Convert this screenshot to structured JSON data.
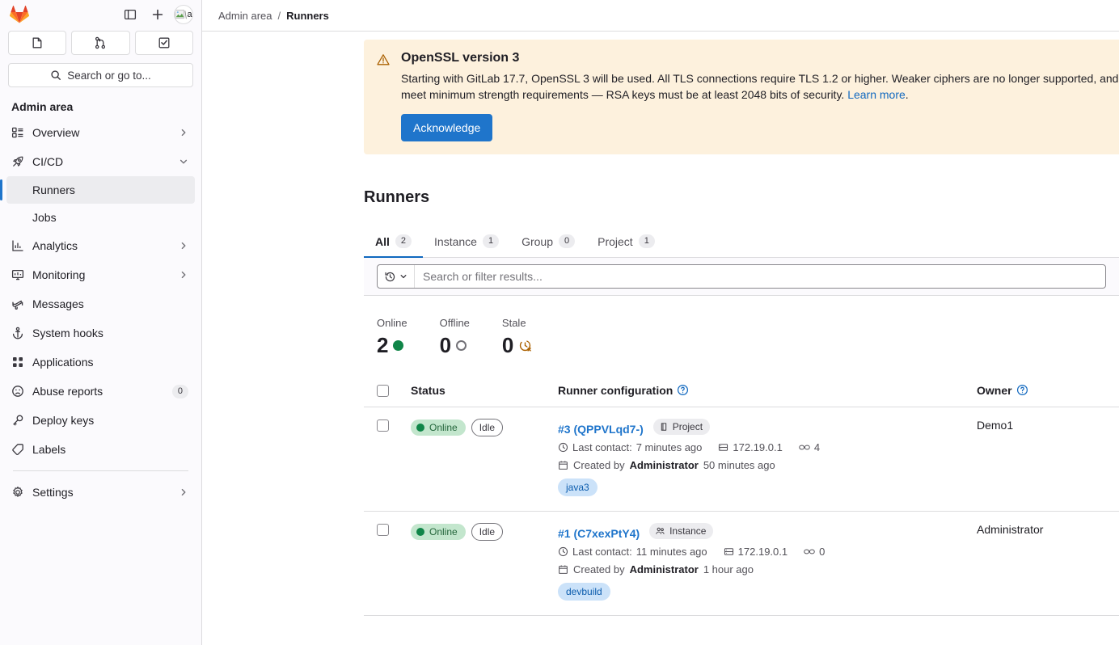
{
  "sidebar": {
    "logo": "gitlab-logo",
    "top_buttons": [
      {
        "name": "sidebar-toggle",
        "icon": "panel-icon"
      },
      {
        "name": "create-new",
        "icon": "plus-icon"
      }
    ],
    "avatar_alt": "a",
    "quick_actions": [
      {
        "name": "issues",
        "icon": "issues-icon"
      },
      {
        "name": "merge-requests",
        "icon": "merge-request-icon"
      },
      {
        "name": "todo-list",
        "icon": "todo-icon"
      }
    ],
    "search_label": "Search or go to...",
    "context_title": "Admin area",
    "items": [
      {
        "label": "Overview",
        "icon": "overview-icon",
        "chevron": "right",
        "badge": null
      },
      {
        "label": "CI/CD",
        "icon": "rocket-icon",
        "chevron": "down",
        "badge": null
      },
      {
        "label": "Analytics",
        "icon": "chart-icon",
        "chevron": "right",
        "badge": null
      },
      {
        "label": "Monitoring",
        "icon": "monitor-icon",
        "chevron": "right",
        "badge": null
      },
      {
        "label": "Messages",
        "icon": "megaphone-icon",
        "chevron": null,
        "badge": null
      },
      {
        "label": "System hooks",
        "icon": "anchor-icon",
        "chevron": null,
        "badge": null
      },
      {
        "label": "Applications",
        "icon": "applications-icon",
        "chevron": null,
        "badge": null
      },
      {
        "label": "Abuse reports",
        "icon": "abuse-icon",
        "chevron": null,
        "badge": "0"
      },
      {
        "label": "Deploy keys",
        "icon": "key-icon",
        "chevron": null,
        "badge": null
      },
      {
        "label": "Labels",
        "icon": "label-icon",
        "chevron": null,
        "badge": null
      },
      {
        "label": "Settings",
        "icon": "gear-icon",
        "chevron": "right",
        "badge": null
      }
    ],
    "cicd_children": [
      {
        "label": "Runners",
        "active": true
      },
      {
        "label": "Jobs",
        "active": false
      }
    ]
  },
  "breadcrumb": {
    "parent": "Admin area",
    "separator": "/",
    "current": "Runners"
  },
  "alert": {
    "icon": "warning-icon",
    "title": "OpenSSL version 3",
    "text_before": "Starting with GitLab 17.7, OpenSSL 3 will be used. All TLS connections require TLS 1.2 or higher. Weaker ciphers are no longer supported, and certificates must meet minimum strength requirements — RSA keys must be at least 2048 bits of security.",
    "link_label": "Learn more",
    "period": ".",
    "button_label": "Acknowledge"
  },
  "page": {
    "title": "Runners"
  },
  "tabs": [
    {
      "label": "All",
      "count": "2",
      "active": true
    },
    {
      "label": "Instance",
      "count": "1",
      "active": false
    },
    {
      "label": "Group",
      "count": "0",
      "active": false
    },
    {
      "label": "Project",
      "count": "1",
      "active": false
    }
  ],
  "search": {
    "history_icon": "history-icon",
    "chevron_icon": "chevron-down-icon",
    "placeholder": "Search or filter results...",
    "value": ""
  },
  "stats": [
    {
      "label": "Online",
      "value": "2",
      "indicator": "filled-green-dot",
      "color": "#108548"
    },
    {
      "label": "Offline",
      "value": "0",
      "indicator": "hollow-gray-dot",
      "color": "#737278"
    },
    {
      "label": "Stale",
      "value": "0",
      "indicator": "stale-clock-icon",
      "color": "#ab6100"
    }
  ],
  "table": {
    "headers": {
      "select_all": "select-all-checkbox",
      "status": "Status",
      "runner_configuration": "Runner configuration",
      "owner": "Owner"
    },
    "rows": [
      {
        "checked": false,
        "status_badge": "Online",
        "idle_badge": "Idle",
        "name": "#3 (QPPVLqd7-)",
        "type_badge": "Project",
        "type_icon": "project-icon",
        "last_contact_label": "Last contact:",
        "last_contact_value": "7 minutes ago",
        "ip": "172.19.0.1",
        "jobs_count": "4",
        "created_prefix": "Created by",
        "created_by": "Administrator",
        "created_ago": "50 minutes ago",
        "tag": "java3",
        "owner": "Demo1"
      },
      {
        "checked": false,
        "status_badge": "Online",
        "idle_badge": "Idle",
        "name": "#1 (C7xexPtY4)",
        "type_badge": "Instance",
        "type_icon": "instance-icon",
        "last_contact_label": "Last contact:",
        "last_contact_value": "11 minutes ago",
        "ip": "172.19.0.1",
        "jobs_count": "0",
        "created_prefix": "Created by",
        "created_by": "Administrator",
        "created_ago": "1 hour ago",
        "tag": "devbuild",
        "owner": "Administrator"
      }
    ]
  },
  "colors": {
    "brand_orange": "#fc6d26",
    "link_blue": "#1f75cb",
    "online_green": "#108548",
    "warning_bg": "#fdf1dd",
    "warning_fg": "#ab6100",
    "tag_bg": "#cbe2f9",
    "tag_fg": "#0b5cad"
  }
}
